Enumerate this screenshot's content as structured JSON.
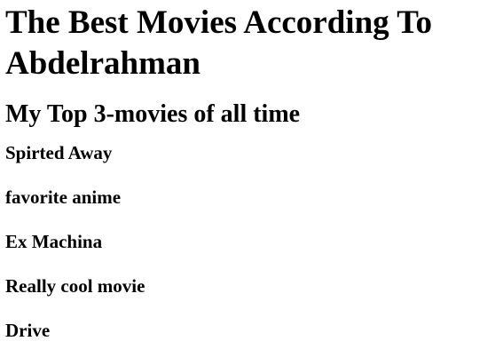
{
  "page": {
    "title": "The Best Movies According To Abdelrahman",
    "subtitle": "My Top 3-movies of all time"
  },
  "movies": [
    {
      "title": "Spirted Away",
      "note": "favorite anime"
    },
    {
      "title": "Ex Machina",
      "note": "Really cool movie"
    },
    {
      "title": "Drive"
    }
  ]
}
